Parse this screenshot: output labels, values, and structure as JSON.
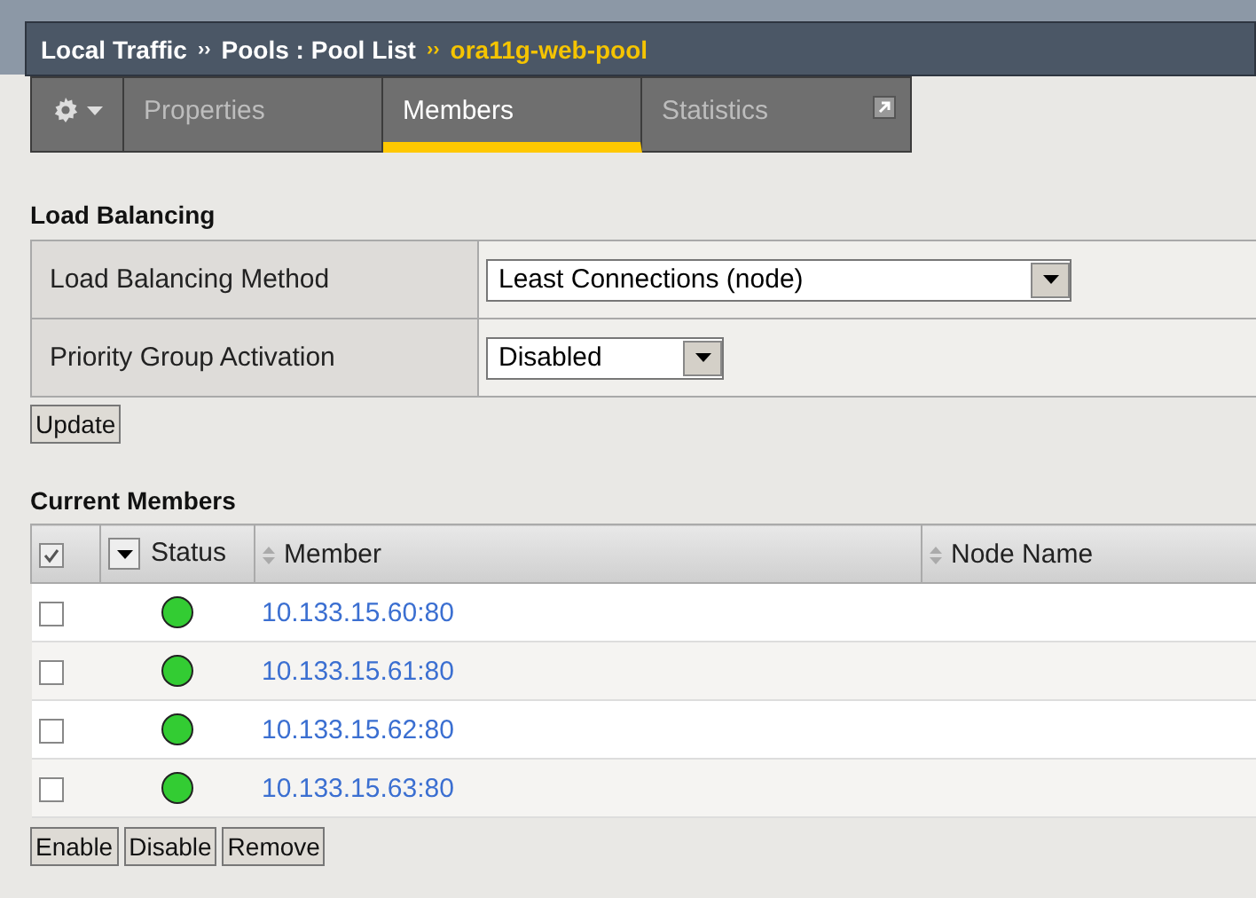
{
  "breadcrumb": {
    "items": [
      "Local Traffic",
      "Pools : Pool List"
    ],
    "current": "ora11g-web-pool",
    "separator": "››"
  },
  "tabs": [
    {
      "kind": "menu"
    },
    {
      "kind": "tab",
      "label": "Properties",
      "selected": false
    },
    {
      "kind": "tab",
      "label": "Members",
      "selected": true
    },
    {
      "kind": "tab",
      "label": "Statistics",
      "selected": false,
      "popout": true
    }
  ],
  "load_balancing": {
    "title": "Load Balancing",
    "rows": [
      {
        "label": "Load Balancing Method",
        "value": "Least Connections (node)",
        "wide": true
      },
      {
        "label": "Priority Group Activation",
        "value": "Disabled",
        "wide": false
      }
    ],
    "button": "Update"
  },
  "members": {
    "title": "Current Members",
    "select_all": {
      "checked": true
    },
    "columns": [
      {
        "label": "Status",
        "sortable": false,
        "menu": true
      },
      {
        "label": "Member",
        "sortable": true
      },
      {
        "label": "Node Name",
        "sortable": true
      }
    ],
    "rows": [
      {
        "checked": false,
        "color": "#33cc33",
        "member": "10.133.15.60:80"
      },
      {
        "checked": false,
        "color": "#33cc33",
        "member": "10.133.15.61:80"
      },
      {
        "checked": false,
        "color": "#33cc33",
        "member": "10.133.15.62:80"
      },
      {
        "checked": false,
        "color": "#33cc33",
        "member": "10.133.15.63:80"
      }
    ],
    "buttons": [
      "Enable",
      "Disable",
      "Remove"
    ]
  }
}
